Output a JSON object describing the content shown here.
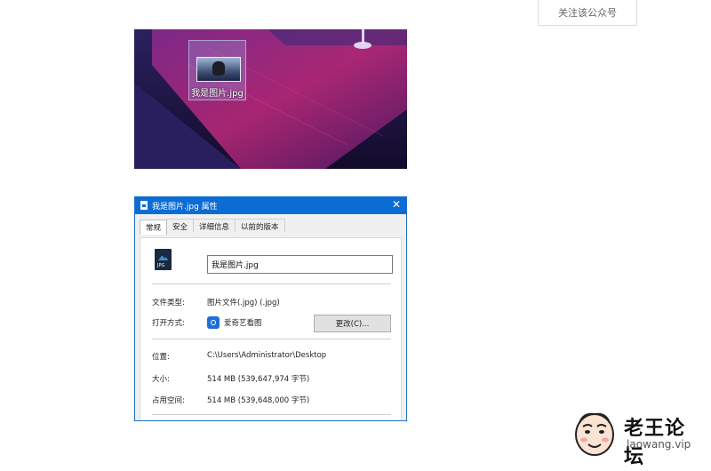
{
  "follow_button": {
    "label": "关注该公众号"
  },
  "desktop": {
    "icon_label": "我是图片.jpg"
  },
  "dialog": {
    "title": "我是图片.jpg 属性",
    "close_glyph": "✕",
    "tabs": [
      {
        "label": "常规",
        "active": true
      },
      {
        "label": "安全",
        "active": false
      },
      {
        "label": "详细信息",
        "active": false
      },
      {
        "label": "以前的版本",
        "active": false
      }
    ],
    "filename_value": "我是图片.jpg",
    "file_type_label": "文件类型:",
    "file_type_value": "图片文件(.jpg) (.jpg)",
    "open_with_label": "打开方式:",
    "open_with_value": "爱奇艺看图",
    "change_button_label": "更改(C)...",
    "location_label": "位置:",
    "location_value": "C:\\Users\\Administrator\\Desktop",
    "size_label": "大小:",
    "size_value": "514 MB (539,647,974 字节)",
    "disk_size_label": "占用空间:",
    "disk_size_value": "514 MB (539,648,000 字节)"
  },
  "watermark": {
    "title": "老王论坛",
    "url": "laowang.vip"
  }
}
